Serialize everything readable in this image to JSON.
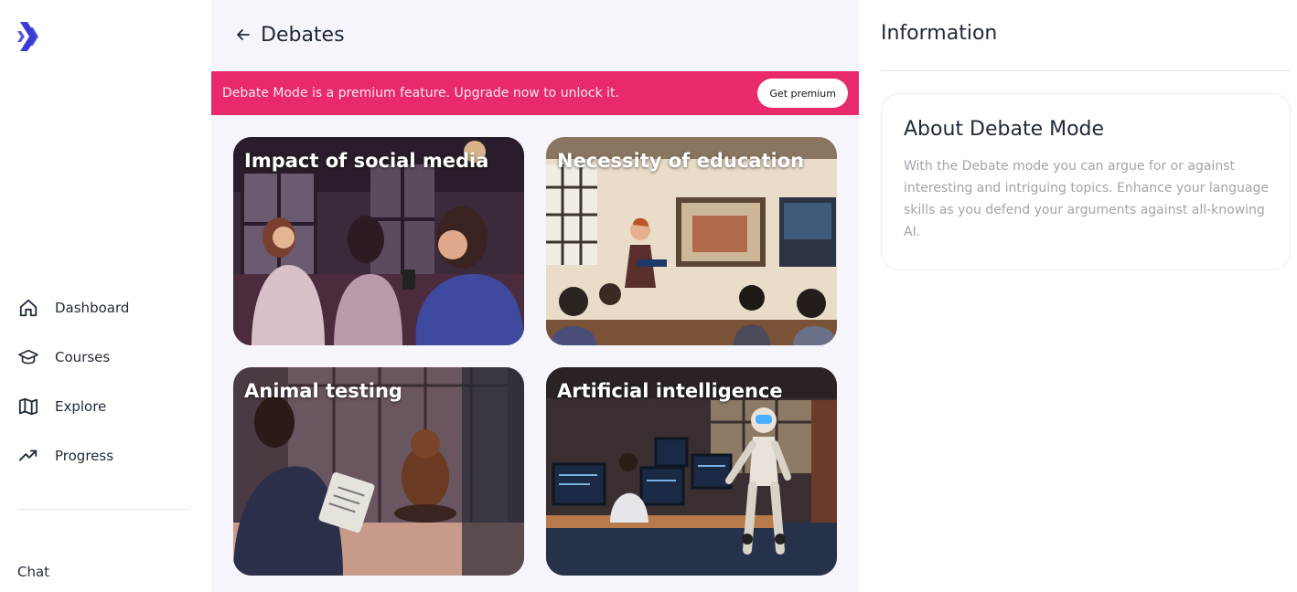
{
  "sidebar": {
    "logo_icon": "brand-chevrons-icon",
    "brand_color": "#3b3bd4",
    "nav": [
      {
        "label": "Dashboard",
        "icon": "home-icon"
      },
      {
        "label": "Courses",
        "icon": "graduation-cap-icon"
      },
      {
        "label": "Explore",
        "icon": "map-icon"
      },
      {
        "label": "Progress",
        "icon": "trending-up-icon"
      }
    ],
    "chat_label": "Chat"
  },
  "main": {
    "title": "Debates",
    "back_icon": "arrow-left-icon",
    "banner": {
      "text": "Debate Mode is a premium feature. Upgrade now to unlock it.",
      "button_label": "Get premium",
      "color": "#e8296c"
    },
    "topics": [
      {
        "title": "Impact of social media"
      },
      {
        "title": "Necessity of education"
      },
      {
        "title": "Animal testing"
      },
      {
        "title": "Artificial intelligence"
      }
    ]
  },
  "info": {
    "title": "Information",
    "about_title": "About Debate Mode",
    "about_text": "With the Debate mode you can argue for or against interesting and intriguing topics. Enhance your language skills as you defend your arguments against all-knowing AI."
  }
}
